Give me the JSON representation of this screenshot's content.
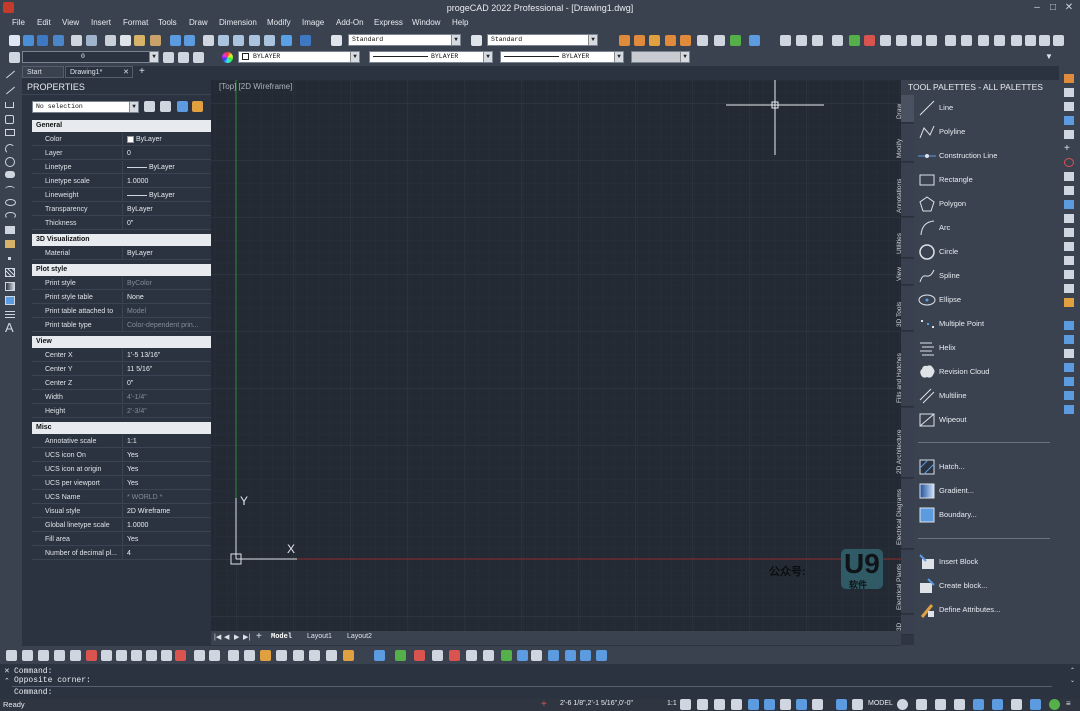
{
  "window": {
    "title": "progeCAD 2022 Professional - [Drawing1.dwg]"
  },
  "menu": [
    "File",
    "Edit",
    "View",
    "Insert",
    "Format",
    "Tools",
    "Draw",
    "Dimension",
    "Modify",
    "Image",
    "Add-On",
    "Express",
    "Window",
    "Help"
  ],
  "toolbar": {
    "textstyle": "Standard",
    "dimstyle": "Standard",
    "layer": "0",
    "color": "BYLAYER",
    "linetype": "BYLAYER",
    "lineweight": "BYLAYER"
  },
  "doc_tabs": [
    "Start Page",
    "Drawing1*"
  ],
  "properties": {
    "title": "PROPERTIES",
    "selection": "No selection",
    "sections": [
      {
        "name": "General",
        "rows": [
          {
            "k": "Color",
            "v": "ByLayer"
          },
          {
            "k": "Layer",
            "v": "0"
          },
          {
            "k": "Linetype",
            "v": "ByLayer"
          },
          {
            "k": "Linetype scale",
            "v": "1.0000"
          },
          {
            "k": "Lineweight",
            "v": "ByLayer"
          },
          {
            "k": "Transparency",
            "v": "ByLayer"
          },
          {
            "k": "Thickness",
            "v": "0\""
          }
        ]
      },
      {
        "name": "3D Visualization",
        "rows": [
          {
            "k": "Material",
            "v": "ByLayer"
          }
        ]
      },
      {
        "name": "Plot style",
        "rows": [
          {
            "k": "Print style",
            "v": "ByColor"
          },
          {
            "k": "Print style table",
            "v": "None"
          },
          {
            "k": "Print table attached to",
            "v": "Model"
          },
          {
            "k": "Print table type",
            "v": "Color-dependent prin..."
          }
        ]
      },
      {
        "name": "View",
        "rows": [
          {
            "k": "Center X",
            "v": "1'-5 13/16\""
          },
          {
            "k": "Center Y",
            "v": "11 5/16\""
          },
          {
            "k": "Center Z",
            "v": "0\""
          },
          {
            "k": "Width",
            "v": "4'-1/4\""
          },
          {
            "k": "Height",
            "v": "2'-3/4\""
          }
        ]
      },
      {
        "name": "Misc",
        "rows": [
          {
            "k": "Annotative scale",
            "v": "1:1"
          },
          {
            "k": "UCS icon On",
            "v": "Yes"
          },
          {
            "k": "UCS icon at origin",
            "v": "Yes"
          },
          {
            "k": "UCS per viewport",
            "v": "Yes"
          },
          {
            "k": "UCS Name",
            "v": "* WORLD *"
          },
          {
            "k": "Visual style",
            "v": "2D Wireframe"
          },
          {
            "k": "Global linetype scale",
            "v": "1.0000"
          },
          {
            "k": "Fill area",
            "v": "Yes"
          },
          {
            "k": "Number of decimal pl...",
            "v": "4"
          }
        ]
      }
    ]
  },
  "viewport": {
    "label": "[Top] [2D Wireframe]",
    "ucs_x": "X",
    "ucs_y": "Y"
  },
  "layout_tabs": [
    "Model",
    "Layout1",
    "Layout2"
  ],
  "palette": {
    "title": "TOOL PALETTES - ALL PALETTES",
    "tabs": [
      "Draw",
      "Modify",
      "Annotations",
      "Utilities",
      "View",
      "3D Tools",
      "Fills and Hatches",
      "2D Architecture",
      "Electrical Diagrams",
      "Electrical Plants",
      "3D"
    ],
    "items": [
      "Line",
      "Polyline",
      "Construction Line",
      "Rectangle",
      "Polygon",
      "Arc",
      "Circle",
      "Spline",
      "Ellipse",
      "Multiple Point",
      "Helix",
      "Revision Cloud",
      "Multiline",
      "Wipeout"
    ],
    "items2": [
      "Hatch...",
      "Gradient...",
      "Boundary..."
    ],
    "items3": [
      "Insert Block",
      "Create block...",
      "Define Attributes..."
    ]
  },
  "command": {
    "lines": [
      "Command:",
      "Opposite corner:",
      "Command:"
    ]
  },
  "status": {
    "ready": "Ready",
    "coords": "2'-6 1/8\",2'-1 5/16\",0'-0\"",
    "scale": "1:1",
    "model": "MODEL"
  },
  "watermark": {
    "label": "公众号:",
    "logo": "U9",
    "sub": "软件"
  }
}
